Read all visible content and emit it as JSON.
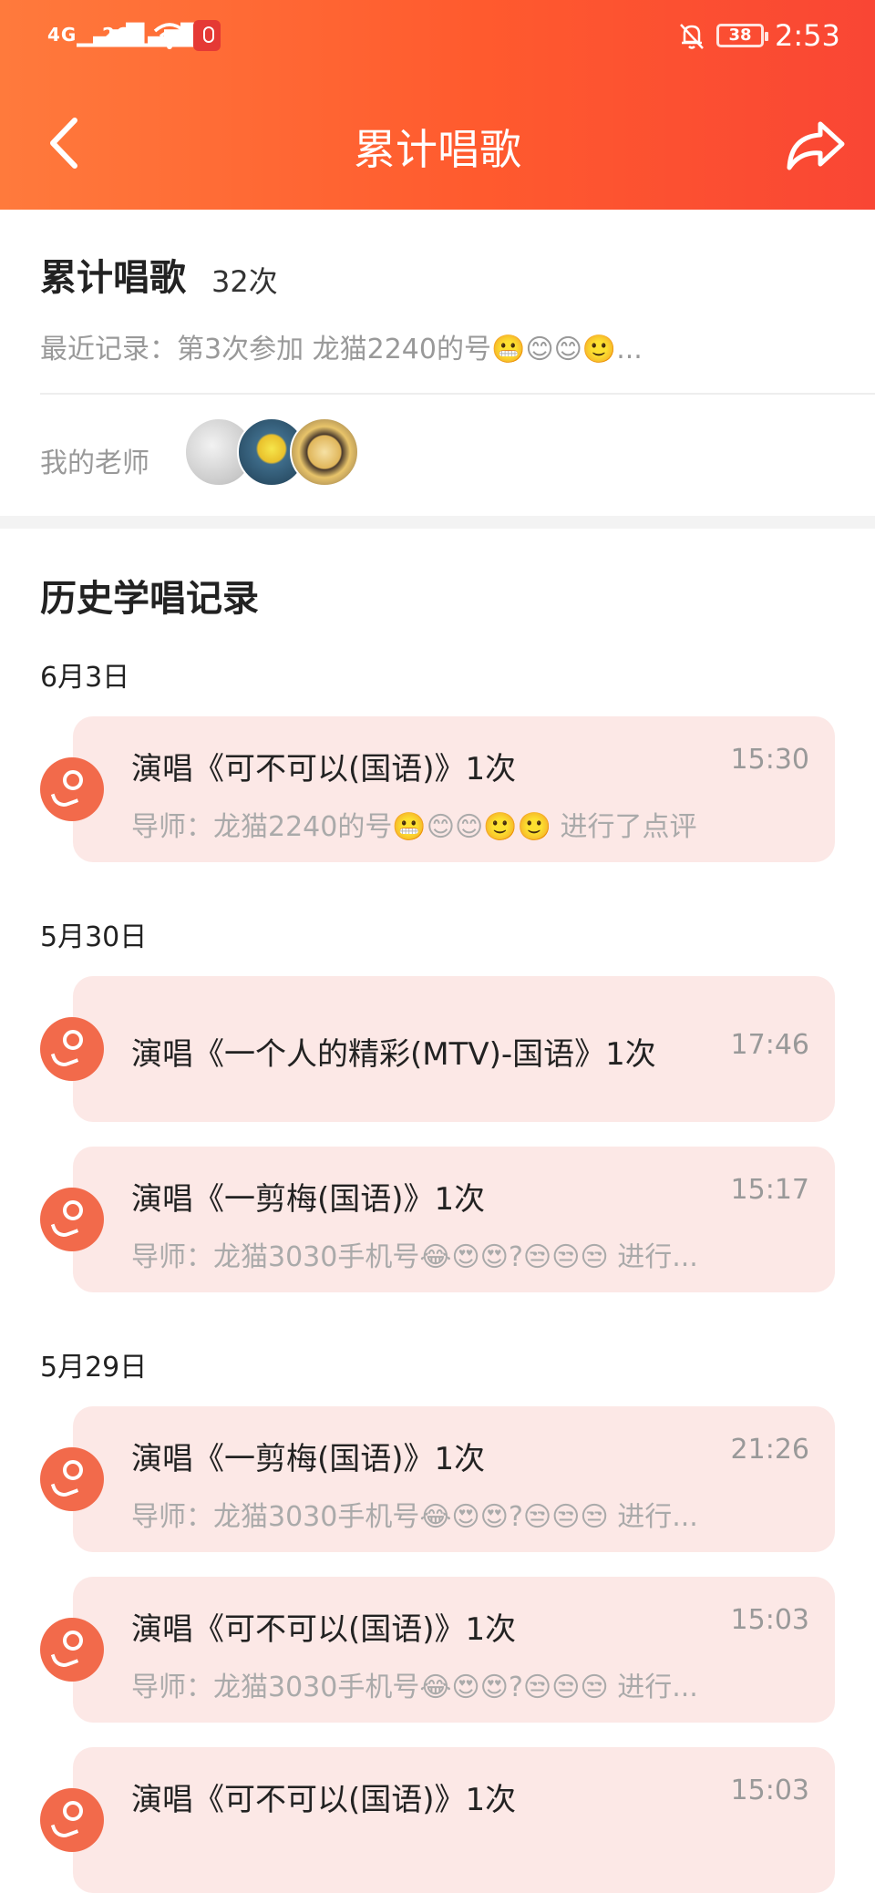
{
  "status_bar": {
    "signal1": "4G",
    "signal2": "2G",
    "battery": "38",
    "time": "2:53"
  },
  "nav": {
    "title": "累计唱歌"
  },
  "summary": {
    "title": "累计唱歌",
    "count": "32次",
    "recent": "最近记录：第3次参加 龙猫2240的号😬😊😊🙂...",
    "teacher_label": "我的老师"
  },
  "history": {
    "title": "历史学唱记录",
    "groups": [
      {
        "date": "6月3日",
        "records": [
          {
            "song": "演唱《可不可以(国语)》1次",
            "time": "15:30",
            "teacher": "导师：龙猫2240的号😬😊😊🙂🙂 进行了点评"
          }
        ]
      },
      {
        "date": "5月30日",
        "records": [
          {
            "song": "演唱《一个人的精彩(MTV)-国语》1次",
            "time": "17:46",
            "teacher": ""
          },
          {
            "song": "演唱《一剪梅(国语)》1次",
            "time": "15:17",
            "teacher": "导师：龙猫3030手机号😂😍😍?😒😒😒 进行..."
          }
        ]
      },
      {
        "date": "5月29日",
        "records": [
          {
            "song": "演唱《一剪梅(国语)》1次",
            "time": "21:26",
            "teacher": "导师：龙猫3030手机号😂😍😍?😒😒😒 进行..."
          },
          {
            "song": "演唱《可不可以(国语)》1次",
            "time": "15:03",
            "teacher": "导师：龙猫3030手机号😂😍😍?😒😒😒 进行..."
          },
          {
            "song": "演唱《可不可以(国语)》1次",
            "time": "15:03",
            "teacher": ""
          }
        ]
      }
    ]
  },
  "colors": {
    "header_start": "#ff7a3c",
    "header_end": "#f94634",
    "card_bg": "#fce8e6",
    "icon_bg": "#f26a4b"
  }
}
